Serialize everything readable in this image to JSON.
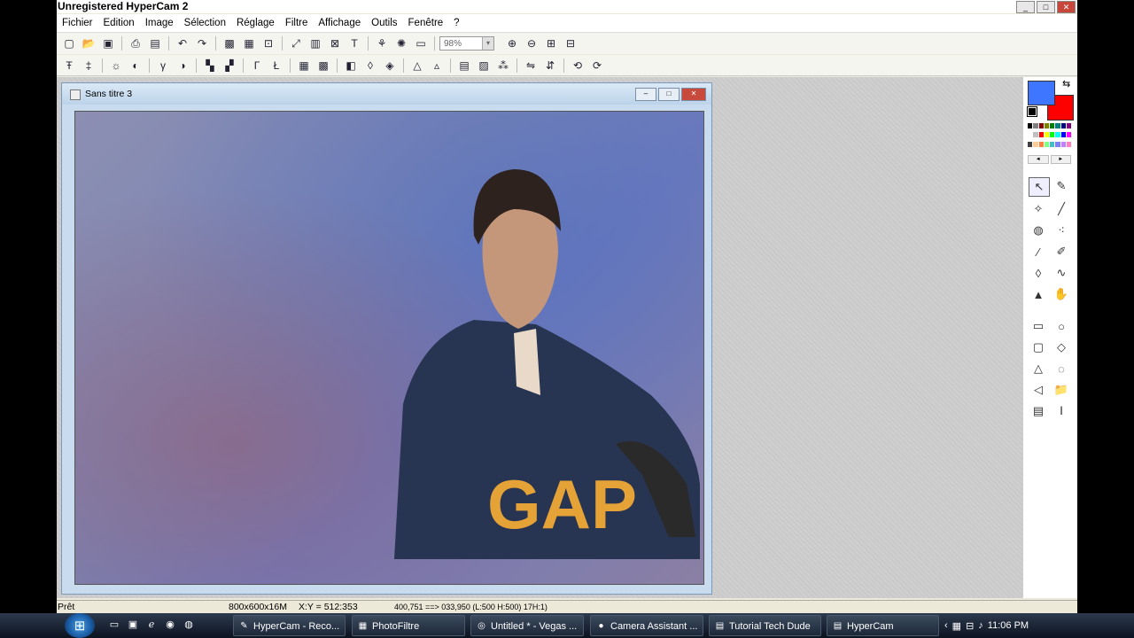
{
  "window": {
    "title": "Unregistered HyperCam 2",
    "buttons": [
      "_",
      "□",
      "✕"
    ]
  },
  "menu": [
    "Fichier",
    "Edition",
    "Image",
    "Sélection",
    "Réglage",
    "Filtre",
    "Affichage",
    "Outils",
    "Fenêtre",
    "?"
  ],
  "toolbar1": {
    "icons": [
      "new-icon",
      "open-icon",
      "save-icon",
      "sep",
      "print-icon",
      "scan-icon",
      "sep",
      "undo-icon",
      "redo-icon",
      "sep",
      "select-all-icon",
      "image-icon",
      "crop-icon",
      "sep",
      "resize-icon",
      "canvas-icon",
      "fit-icon",
      "text-icon",
      "sep",
      "tree-icon",
      "filter-icon",
      "web-icon",
      "sep"
    ],
    "zoom_value": "98%",
    "icons2": [
      "zoom-in-icon",
      "zoom-out-icon",
      "actual-size-icon",
      "fullscreen-icon"
    ]
  },
  "toolbar2_icons": [
    "auto-level-icon",
    "auto-contrast-icon",
    "sep",
    "brightness-icon",
    "contrast-icon",
    "sep",
    "gamma-icon",
    "saturation-icon",
    "sep",
    "color-icon",
    "hue-icon",
    "sep",
    "curve-icon",
    "level-icon",
    "sep",
    "grid-icon",
    "mosaic-icon",
    "sep",
    "mirror-icon",
    "drop-icon",
    "blur-icon",
    "sep",
    "triangle-icon",
    "sharpen-icon",
    "sep",
    "palette-icon",
    "rgb-icon",
    "noise-icon",
    "sep",
    "flip-h-icon",
    "flip-v-icon",
    "sep",
    "rotate-left-icon",
    "rotate-right-icon"
  ],
  "document": {
    "title": "Sans titre 3",
    "buttons": [
      "‒",
      "□",
      "✕"
    ]
  },
  "colors": {
    "foreground": "#3f76ff",
    "background": "#ff0000"
  },
  "palette": [
    "#000000",
    "#808080",
    "#800000",
    "#808000",
    "#008000",
    "#008080",
    "#000080",
    "#800080",
    "#ffffff",
    "#c0c0c0",
    "#ff0000",
    "#ffff00",
    "#00ff00",
    "#00ffff",
    "#0000ff",
    "#ff00ff",
    "#404040",
    "#ffcc99",
    "#ff8040",
    "#80ff80",
    "#40c0c0",
    "#8080ff",
    "#c080ff",
    "#ff80c0"
  ],
  "tools": [
    "pointer-icon",
    "eyedropper-icon",
    "magic-wand-icon",
    "line-icon",
    "fill-icon",
    "spray-icon",
    "brush-icon",
    "advanced-brush-icon",
    "drop-icon",
    "smudge-icon",
    "stamp-icon",
    "hand-icon",
    "gap",
    "rectangle-icon",
    "ellipse-icon",
    "rounded-rect-icon",
    "diamond-icon",
    "triangle-icon",
    "lasso-icon",
    "polygon-icon",
    "folder-icon",
    "selection-icon",
    "text-selection-icon"
  ],
  "status": {
    "ready": "Prêt",
    "size": "800x600x16M",
    "coords": "X:Y = 512:353",
    "extra": "400,751 ==> 033,950 (L:500 H:500) 17H:1)"
  },
  "taskbar": {
    "tasks": [
      {
        "label": "HyperCam - Reco...",
        "icon": "✎"
      },
      {
        "label": "PhotoFiltre",
        "icon": "▦"
      },
      {
        "label": "Untitled * - Vegas ...",
        "icon": "◎"
      },
      {
        "label": "Camera Assistant ...",
        "icon": "●"
      },
      {
        "label": "Tutorial Tech Dude",
        "icon": "▤"
      },
      {
        "label": "HyperCam",
        "icon": "▤"
      }
    ],
    "clock": "11:06 PM"
  }
}
